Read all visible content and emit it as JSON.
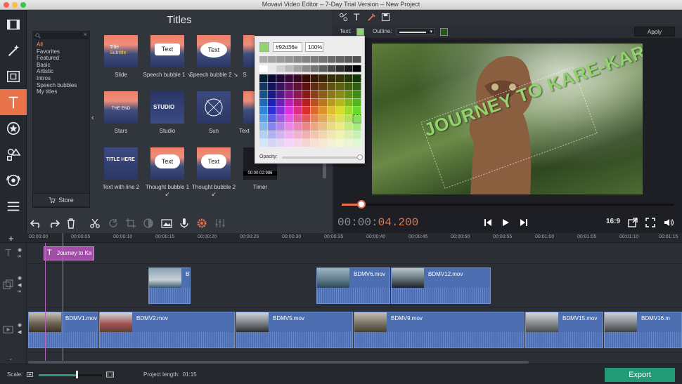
{
  "window": {
    "title": "Movavi Video Editor – 7-Day Trial Version – New Project"
  },
  "left_tools": [
    "film-import-icon",
    "magic-wand-icon",
    "filmstrip-icon",
    "titles-icon",
    "stickers-icon",
    "shapes-icon",
    "callouts-icon",
    "menu-icon"
  ],
  "titles_panel": {
    "heading": "Titles",
    "categories": [
      "All",
      "Favorites",
      "Featured",
      "Basic",
      "Artistic",
      "Intros",
      "Speech bubbles",
      "My titles"
    ],
    "selected_category": "All",
    "store_label": "Store",
    "thumbs": [
      {
        "caption": "Slide",
        "overlay": "Title\nSubtitle"
      },
      {
        "caption": "Speech bubble 1 ↘",
        "overlay": "Text"
      },
      {
        "caption": "Speech bubble 2 ↘",
        "overlay": "Text"
      },
      {
        "caption": "S",
        "overlay": ""
      },
      {
        "caption": "Stars",
        "overlay": "THE END"
      },
      {
        "caption": "Studio",
        "overlay": "STUDIO"
      },
      {
        "caption": "Sun",
        "overlay": ""
      },
      {
        "caption": "Text",
        "overlay": ""
      },
      {
        "caption": "Text with line 2",
        "overlay": "TITLE HERE"
      },
      {
        "caption": "Thought bubble 1 ↙",
        "overlay": "Text"
      },
      {
        "caption": "Thought bubble 2 ↙",
        "overlay": "Text"
      },
      {
        "caption": "Timer",
        "overlay": "00:00:02:986"
      }
    ]
  },
  "color_picker": {
    "hex": "#92d36e",
    "opacity_value": "100%",
    "opacity_label": "Opacity:",
    "selected_color": "#92d36e"
  },
  "preview": {
    "text_label": "Text:",
    "outline_label": "Outline:",
    "apply_label": "Apply",
    "text_color": "#92d36e",
    "outline_color": "#1f5a1c",
    "overlay_text": "JOURNEY TO KARE-KARE",
    "seek_position": 0.06
  },
  "timecode": {
    "dim": "00:00:",
    "active": "04.200"
  },
  "aspect": "16:9",
  "ruler_ticks": [
    "00:00:00",
    "00:00:05",
    "00:00:10",
    "00:00:15",
    "00:00:20",
    "00:00:25",
    "00:00:30",
    "00:00:35",
    "00:00:40",
    "00:00:45",
    "00:00:50",
    "00:00:55",
    "00:01:00",
    "00:01:05",
    "00:01:10",
    "00:01:15"
  ],
  "title_clip": "Journey to Ka",
  "overlay_clips": [
    "Bl",
    "BDMV6.mov",
    "BDMV12.mov"
  ],
  "main_clips": [
    "BDMV1.mov",
    "BDMV2.mov",
    "BDMV5.mov",
    "BDMV9.mov",
    "BDMV15.mov",
    "BDMV16.m"
  ],
  "bottom": {
    "scale_label": "Scale:",
    "scale_level": 0.6,
    "project_length_label": "Project length:",
    "project_length": "01:15",
    "export_label": "Export"
  }
}
